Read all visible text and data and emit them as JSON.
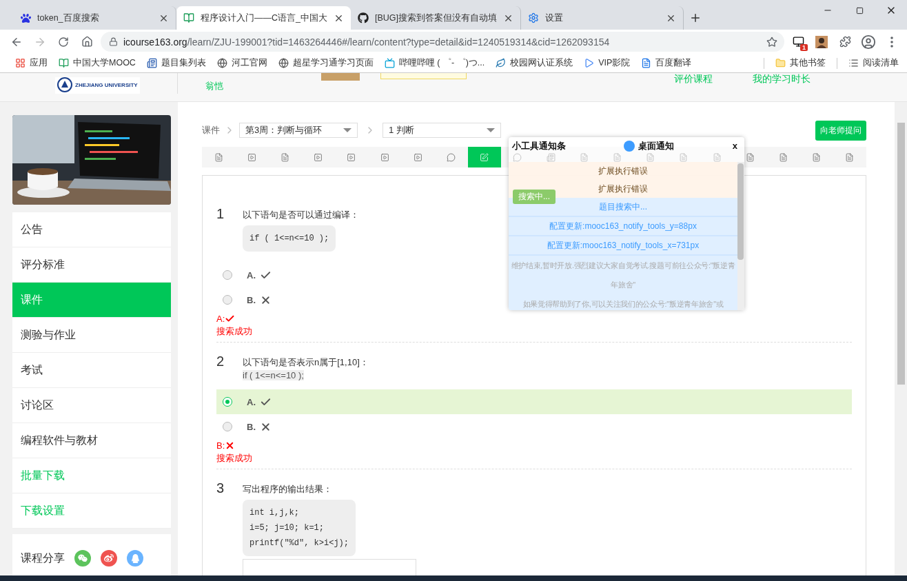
{
  "browser": {
    "tabs": [
      {
        "title": "token_百度搜索",
        "selected": false
      },
      {
        "title": "程序设计入门——C语言_中国大",
        "selected": true
      },
      {
        "title": "[BUG]搜索到答案但没有自动填",
        "selected": false
      },
      {
        "title": "设置",
        "selected": false
      }
    ],
    "address": {
      "host": "icourse163.org",
      "path": "/learn/ZJU-199001?tid=1463264446#/learn/content?type=detail&id=1240519314&cid=1262093154"
    },
    "extension_badge": "1",
    "bookmarks": [
      {
        "label": "应用"
      },
      {
        "label": "中国大学MOOC"
      },
      {
        "label": "题目集列表"
      },
      {
        "label": "河工官网"
      },
      {
        "label": "超星学习通学习页面"
      },
      {
        "label": "哔哩哔哩 ( ゜- ゜)つ..."
      },
      {
        "label": "校园网认证系统"
      },
      {
        "label": "VIP影院"
      },
      {
        "label": "百度翻译"
      }
    ],
    "bookmarks_right": [
      {
        "label": "其他书签"
      },
      {
        "label": "阅读清单"
      }
    ]
  },
  "page_header": {
    "logo_caption": "ZHEJIANG UNIVERSITY",
    "teacher": "翁恺",
    "links": [
      "评价课程",
      "我的学习时长"
    ]
  },
  "sidebar": {
    "menu": [
      {
        "label": "公告",
        "kind": "nav",
        "selected": false
      },
      {
        "label": "评分标准",
        "kind": "nav",
        "selected": false
      },
      {
        "label": "课件",
        "kind": "nav",
        "selected": true
      },
      {
        "label": "测验与作业",
        "kind": "nav",
        "selected": false
      },
      {
        "label": "考试",
        "kind": "nav",
        "selected": false
      },
      {
        "label": "讨论区",
        "kind": "nav",
        "selected": false
      },
      {
        "label": "编程软件与教材",
        "kind": "nav",
        "selected": false
      },
      {
        "label": "批量下载",
        "kind": "action",
        "selected": false
      },
      {
        "label": "下载设置",
        "kind": "action",
        "selected": false
      }
    ],
    "share_label": "课程分享"
  },
  "course": {
    "breadcrumb_root": "课件",
    "selects": [
      "第3周：判断与循环",
      "1 判断"
    ],
    "ask_button": "向老师提问",
    "units": [
      {
        "kind": "doc",
        "selected": false
      },
      {
        "kind": "video",
        "selected": false
      },
      {
        "kind": "doc",
        "selected": false
      },
      {
        "kind": "video",
        "selected": false
      },
      {
        "kind": "video",
        "selected": false
      },
      {
        "kind": "video",
        "selected": false
      },
      {
        "kind": "video",
        "selected": false
      },
      {
        "kind": "discuss",
        "selected": false
      },
      {
        "kind": "quiz",
        "selected": true
      },
      {
        "kind": "discuss",
        "selected": false
      },
      {
        "kind": "note",
        "selected": false
      },
      {
        "kind": "doc",
        "selected": false
      },
      {
        "kind": "doc",
        "selected": false
      },
      {
        "kind": "doc",
        "selected": false
      },
      {
        "kind": "doc",
        "selected": false
      },
      {
        "kind": "doc",
        "selected": false
      },
      {
        "kind": "doc",
        "selected": false
      },
      {
        "kind": "doc",
        "selected": false
      },
      {
        "kind": "doc",
        "selected": false
      },
      {
        "kind": "doc",
        "selected": false
      }
    ]
  },
  "questions": [
    {
      "kind": "choice",
      "number": "1",
      "prompt": "以下语句是否可以通过编译：",
      "code_boxed": true,
      "code": [
        "if ( 1<=n<=10 );"
      ],
      "options": [
        {
          "label": "A.",
          "correct": true,
          "selected": false
        },
        {
          "label": "B.",
          "correct": false,
          "selected": false
        }
      ],
      "result": {
        "label": "A:",
        "correct": true,
        "status": "搜索成功"
      }
    },
    {
      "kind": "choice",
      "number": "2",
      "prompt": "以下语句是否表示n属于[1,10]：",
      "code_boxed": false,
      "code": [
        "if ( 1<=n<=10 );"
      ],
      "options": [
        {
          "label": "A.",
          "correct": true,
          "selected": true
        },
        {
          "label": "B.",
          "correct": false,
          "selected": false
        }
      ],
      "result": {
        "label": "B:",
        "correct": false,
        "status": "搜索成功"
      }
    },
    {
      "kind": "fill",
      "number": "3",
      "prompt": "写出程序的输出结果：",
      "code_boxed": true,
      "code": [
        "int i,j,k;",
        "i=5; j=10; k=1;",
        "printf(\"%d\", k>i<j);"
      ]
    }
  ],
  "notify_panel": {
    "title": "小工具通知条",
    "desktop_label": "桌面通知",
    "close": "x",
    "messages": [
      {
        "kind": "error",
        "text": "扩展执行错误"
      },
      {
        "kind": "error",
        "text": "扩展执行错误"
      },
      {
        "kind": "info",
        "text": "题目搜索中..."
      },
      {
        "kind": "info",
        "text": "配置更新:mooc163_notify_tools_y=88px"
      },
      {
        "kind": "info",
        "text": "配置更新:mooc163_notify_tools_x=731px"
      },
      {
        "kind": "notice",
        "text": "维护结束,暂时开放.强烈建议大家自觉考试.搜题可前往公众号:\"叛逆青年旅舍\""
      },
      {
        "kind": "notice",
        "text": "如果觉得帮助到了你,可以关注我们的公众号:\"叛逆青年旅舍\"或"
      }
    ]
  },
  "search_badge": "搜索中..."
}
